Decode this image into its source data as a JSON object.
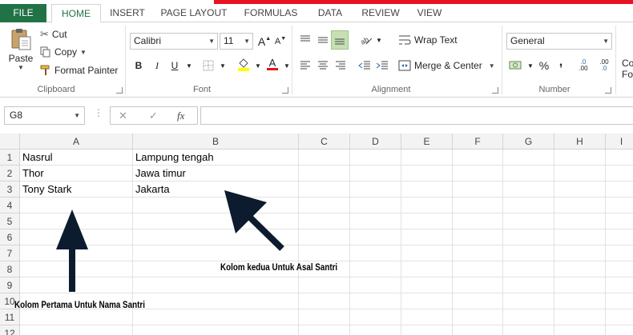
{
  "tabs": [
    {
      "label": "FILE"
    },
    {
      "label": "HOME"
    },
    {
      "label": "INSERT"
    },
    {
      "label": "PAGE LAYOUT"
    },
    {
      "label": "FORMULAS"
    },
    {
      "label": "DATA"
    },
    {
      "label": "REVIEW"
    },
    {
      "label": "VIEW"
    }
  ],
  "clipboard": {
    "paste": "Paste",
    "cut": "Cut",
    "copy": "Copy",
    "format_painter": "Format Painter",
    "label": "Clipboard"
  },
  "font": {
    "name": "Calibri",
    "size": "11",
    "bold": "B",
    "italic": "I",
    "underline": "U",
    "label": "Font",
    "grow": "A",
    "shrink": "A",
    "font_color_glyph": "A"
  },
  "alignment": {
    "wrap_text": "Wrap Text",
    "merge_center": "Merge & Center",
    "label": "Alignment"
  },
  "number": {
    "format": "General",
    "percent": "%",
    "comma": ",",
    "label": "Number",
    "inc_decimal": ".00",
    "dec_decimal": ".0"
  },
  "styles_partial": {
    "line1": "Co",
    "line2": "For"
  },
  "formula_bar": {
    "name_box": "G8",
    "cancel": "✕",
    "enter": "✓",
    "fx": "fx",
    "value": ""
  },
  "columns": [
    "A",
    "B",
    "C",
    "D",
    "E",
    "F",
    "G",
    "H",
    "I"
  ],
  "rows": [
    "1",
    "2",
    "3",
    "4",
    "5",
    "6",
    "7",
    "8",
    "9",
    "10",
    "11",
    "12"
  ],
  "cells": {
    "A1": "Nasrul",
    "B1": "Lampung tengah",
    "A2": "Thor",
    "B2": "Jawa timur",
    "A3": "Tony Stark",
    "B3": "Jakarta"
  },
  "annotations": {
    "col_a": "Kolom Pertama Untuk Nama Santri",
    "col_b": "Kolom kedua Untuk Asal Santri"
  },
  "colors": {
    "accent": "#217346",
    "red_bar": "#e81123",
    "arrow": "#0d1b2e"
  }
}
